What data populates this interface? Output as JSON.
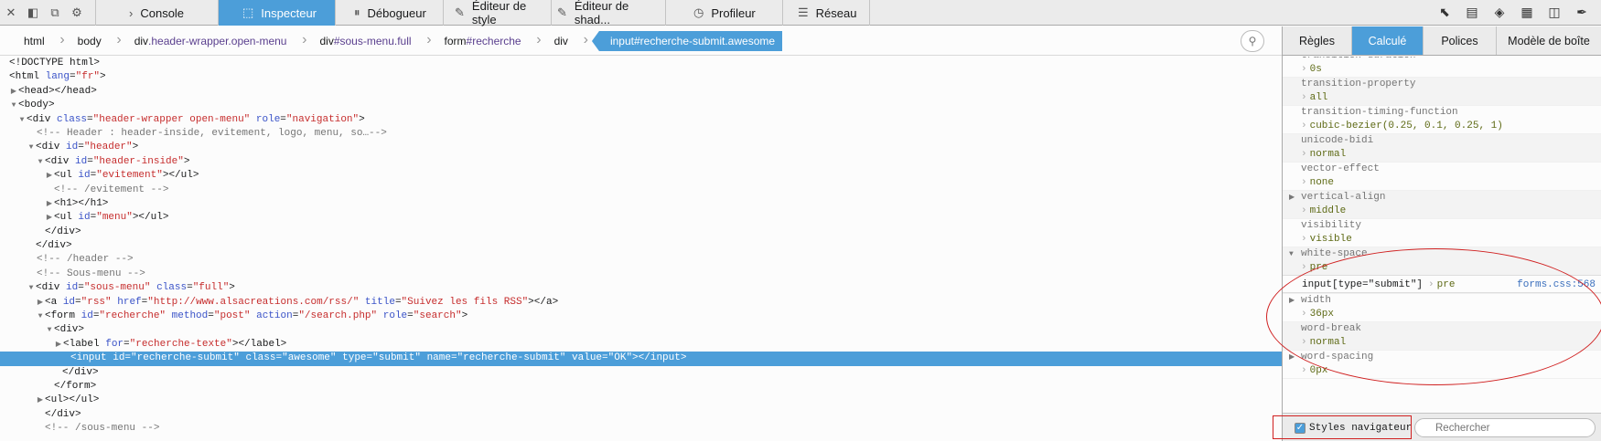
{
  "toolbar": {
    "left_icons": [
      "close-icon",
      "dock-side-icon",
      "undock-icon",
      "gear-icon"
    ],
    "tabs": [
      {
        "label": "Console",
        "icon": "console-icon"
      },
      {
        "label": "Inspecteur",
        "icon": "inspector-icon",
        "selected": true
      },
      {
        "label": "Débogueur",
        "icon": "debugger-icon"
      },
      {
        "label": "Éditeur de style",
        "icon": "style-editor-icon"
      },
      {
        "label": "Éditeur de shad...",
        "icon": "shader-editor-icon"
      },
      {
        "label": "Profileur",
        "icon": "profiler-icon"
      },
      {
        "label": "Réseau",
        "icon": "network-icon"
      }
    ],
    "right_icons": [
      "pick-element-icon",
      "split-console-icon",
      "3d-view-icon",
      "responsive-mode-icon",
      "screenshot-icon",
      "eyedropper-icon"
    ]
  },
  "breadcrumbs": [
    {
      "tag": "html",
      "sel": ""
    },
    {
      "tag": "body",
      "sel": ""
    },
    {
      "tag": "div",
      "sel": ".header-wrapper.open-menu"
    },
    {
      "tag": "div",
      "sel": "#sous-menu.full"
    },
    {
      "tag": "form",
      "sel": "#recherche"
    },
    {
      "tag": "div",
      "sel": ""
    },
    {
      "tag": "input",
      "sel": "#recherche-submit.awesome",
      "active": true
    }
  ],
  "markup": {
    "doctype": "<!DOCTYPE html>",
    "html_open": "<html ",
    "lang_attr": "lang",
    "lang_val": "\"fr\"",
    "head": "<head></head>",
    "body_open": "<body>",
    "div_hw_tag": "<div ",
    "div_hw_class_attr": "class",
    "div_hw_class_val": "\"header-wrapper open-menu\"",
    "div_hw_role_attr": "role",
    "div_hw_role_val": "\"navigation\"",
    "comment_header": "<!-- Header : header-inside, evitement, logo, menu, so…-->",
    "div_header_attr": "id",
    "div_header_val": "\"header\"",
    "div_hi_val": "\"header-inside\"",
    "ul_evit_val": "\"evitement\"",
    "comment_evit": "<!-- /evitement -->",
    "h1": "<h1></h1>",
    "ul_menu_val": "\"menu\"",
    "close_div": "</div>",
    "comment_header_end": "<!-- /header -->",
    "comment_sousmenu": "<!-- Sous-menu -->",
    "div_sm_id": "\"sous-menu\"",
    "div_sm_class": "\"full\"",
    "a_id": "\"rss\"",
    "a_href": "\"http://www.alsacreations.com/rss/\"",
    "a_title": "\"Suivez les fils RSS\"",
    "form_id": "\"recherche\"",
    "form_method": "\"post\"",
    "form_action": "\"/search.php\"",
    "form_role": "\"search\"",
    "div_open": "<div>",
    "label_for": "\"recherche-texte\"",
    "input_id": "\"recherche-submit\"",
    "input_class": "\"awesome\"",
    "input_type": "\"submit\"",
    "input_name": "\"recherche-submit\"",
    "input_value": "\"OK\"",
    "form_close": "</form>",
    "ul_empty": "<ul></ul>",
    "comment_sousmenu_end": "<!-- /sous-menu -->"
  },
  "sidepanel": {
    "tabs": [
      {
        "label": "Règles"
      },
      {
        "label": "Calculé",
        "selected": true
      },
      {
        "label": "Polices"
      },
      {
        "label": "Modèle de boîte"
      }
    ],
    "properties": [
      {
        "name": "transition-duration",
        "value": "0s"
      },
      {
        "name": "transition-property",
        "value": "all"
      },
      {
        "name": "transition-timing-function",
        "value": "cubic-bezier(0.25, 0.1, 0.25, 1)"
      },
      {
        "name": "unicode-bidi",
        "value": "normal"
      },
      {
        "name": "vector-effect",
        "value": "none"
      },
      {
        "name": "vertical-align",
        "value": "middle",
        "expandable": true
      },
      {
        "name": "visibility",
        "value": "visible"
      },
      {
        "name": "white-space",
        "value": "pre",
        "expanded": true
      },
      {
        "name": "width",
        "value": "36px",
        "expandable": true
      },
      {
        "name": "word-break",
        "value": "normal"
      },
      {
        "name": "word-spacing",
        "value": "0px",
        "expandable": true
      }
    ],
    "rule": {
      "selector": "input[type=\"submit\"]",
      "value": "pre",
      "source": "forms.css:568"
    },
    "browser_styles_label": "Styles navigateur",
    "browser_styles_checked": true,
    "filter_placeholder": "Rechercher"
  },
  "annotation_color": "#d02020",
  "accent": "#4c9ed9"
}
